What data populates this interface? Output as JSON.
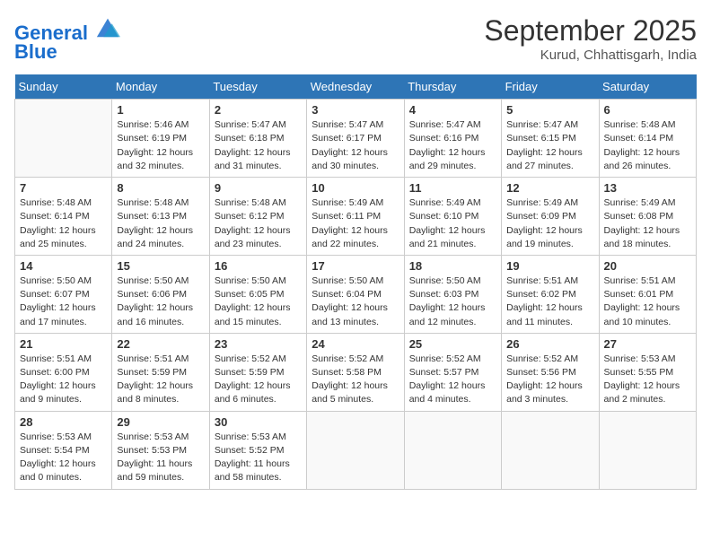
{
  "header": {
    "logo_line1": "General",
    "logo_line2": "Blue",
    "month": "September 2025",
    "location": "Kurud, Chhattisgarh, India"
  },
  "weekdays": [
    "Sunday",
    "Monday",
    "Tuesday",
    "Wednesday",
    "Thursday",
    "Friday",
    "Saturday"
  ],
  "weeks": [
    [
      {
        "day": "",
        "info": ""
      },
      {
        "day": "1",
        "info": "Sunrise: 5:46 AM\nSunset: 6:19 PM\nDaylight: 12 hours\nand 32 minutes."
      },
      {
        "day": "2",
        "info": "Sunrise: 5:47 AM\nSunset: 6:18 PM\nDaylight: 12 hours\nand 31 minutes."
      },
      {
        "day": "3",
        "info": "Sunrise: 5:47 AM\nSunset: 6:17 PM\nDaylight: 12 hours\nand 30 minutes."
      },
      {
        "day": "4",
        "info": "Sunrise: 5:47 AM\nSunset: 6:16 PM\nDaylight: 12 hours\nand 29 minutes."
      },
      {
        "day": "5",
        "info": "Sunrise: 5:47 AM\nSunset: 6:15 PM\nDaylight: 12 hours\nand 27 minutes."
      },
      {
        "day": "6",
        "info": "Sunrise: 5:48 AM\nSunset: 6:14 PM\nDaylight: 12 hours\nand 26 minutes."
      }
    ],
    [
      {
        "day": "7",
        "info": "Sunrise: 5:48 AM\nSunset: 6:14 PM\nDaylight: 12 hours\nand 25 minutes."
      },
      {
        "day": "8",
        "info": "Sunrise: 5:48 AM\nSunset: 6:13 PM\nDaylight: 12 hours\nand 24 minutes."
      },
      {
        "day": "9",
        "info": "Sunrise: 5:48 AM\nSunset: 6:12 PM\nDaylight: 12 hours\nand 23 minutes."
      },
      {
        "day": "10",
        "info": "Sunrise: 5:49 AM\nSunset: 6:11 PM\nDaylight: 12 hours\nand 22 minutes."
      },
      {
        "day": "11",
        "info": "Sunrise: 5:49 AM\nSunset: 6:10 PM\nDaylight: 12 hours\nand 21 minutes."
      },
      {
        "day": "12",
        "info": "Sunrise: 5:49 AM\nSunset: 6:09 PM\nDaylight: 12 hours\nand 19 minutes."
      },
      {
        "day": "13",
        "info": "Sunrise: 5:49 AM\nSunset: 6:08 PM\nDaylight: 12 hours\nand 18 minutes."
      }
    ],
    [
      {
        "day": "14",
        "info": "Sunrise: 5:50 AM\nSunset: 6:07 PM\nDaylight: 12 hours\nand 17 minutes."
      },
      {
        "day": "15",
        "info": "Sunrise: 5:50 AM\nSunset: 6:06 PM\nDaylight: 12 hours\nand 16 minutes."
      },
      {
        "day": "16",
        "info": "Sunrise: 5:50 AM\nSunset: 6:05 PM\nDaylight: 12 hours\nand 15 minutes."
      },
      {
        "day": "17",
        "info": "Sunrise: 5:50 AM\nSunset: 6:04 PM\nDaylight: 12 hours\nand 13 minutes."
      },
      {
        "day": "18",
        "info": "Sunrise: 5:50 AM\nSunset: 6:03 PM\nDaylight: 12 hours\nand 12 minutes."
      },
      {
        "day": "19",
        "info": "Sunrise: 5:51 AM\nSunset: 6:02 PM\nDaylight: 12 hours\nand 11 minutes."
      },
      {
        "day": "20",
        "info": "Sunrise: 5:51 AM\nSunset: 6:01 PM\nDaylight: 12 hours\nand 10 minutes."
      }
    ],
    [
      {
        "day": "21",
        "info": "Sunrise: 5:51 AM\nSunset: 6:00 PM\nDaylight: 12 hours\nand 9 minutes."
      },
      {
        "day": "22",
        "info": "Sunrise: 5:51 AM\nSunset: 5:59 PM\nDaylight: 12 hours\nand 8 minutes."
      },
      {
        "day": "23",
        "info": "Sunrise: 5:52 AM\nSunset: 5:59 PM\nDaylight: 12 hours\nand 6 minutes."
      },
      {
        "day": "24",
        "info": "Sunrise: 5:52 AM\nSunset: 5:58 PM\nDaylight: 12 hours\nand 5 minutes."
      },
      {
        "day": "25",
        "info": "Sunrise: 5:52 AM\nSunset: 5:57 PM\nDaylight: 12 hours\nand 4 minutes."
      },
      {
        "day": "26",
        "info": "Sunrise: 5:52 AM\nSunset: 5:56 PM\nDaylight: 12 hours\nand 3 minutes."
      },
      {
        "day": "27",
        "info": "Sunrise: 5:53 AM\nSunset: 5:55 PM\nDaylight: 12 hours\nand 2 minutes."
      }
    ],
    [
      {
        "day": "28",
        "info": "Sunrise: 5:53 AM\nSunset: 5:54 PM\nDaylight: 12 hours\nand 0 minutes."
      },
      {
        "day": "29",
        "info": "Sunrise: 5:53 AM\nSunset: 5:53 PM\nDaylight: 11 hours\nand 59 minutes."
      },
      {
        "day": "30",
        "info": "Sunrise: 5:53 AM\nSunset: 5:52 PM\nDaylight: 11 hours\nand 58 minutes."
      },
      {
        "day": "",
        "info": ""
      },
      {
        "day": "",
        "info": ""
      },
      {
        "day": "",
        "info": ""
      },
      {
        "day": "",
        "info": ""
      }
    ]
  ]
}
